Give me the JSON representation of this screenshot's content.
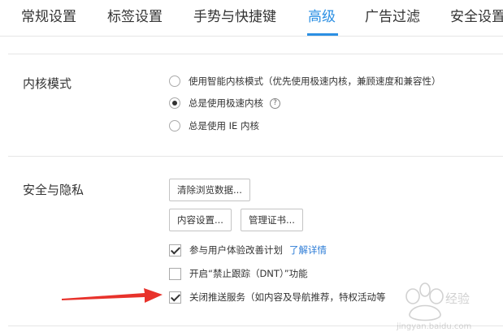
{
  "tabs": [
    {
      "label": "常规设置",
      "active": false
    },
    {
      "label": "标签设置",
      "active": false
    },
    {
      "label": "手势与快捷键",
      "active": false
    },
    {
      "label": "高级",
      "active": true
    },
    {
      "label": "广告过滤",
      "active": false
    },
    {
      "label": "安全设置",
      "active": false
    }
  ],
  "kernel": {
    "title": "内核模式",
    "options": [
      {
        "label": "使用智能内核模式（优先使用极速内核，兼顾速度和兼容性）",
        "checked": false
      },
      {
        "label": "总是使用极速内核",
        "checked": true,
        "help": "?"
      },
      {
        "label": "总是使用 IE 内核",
        "checked": false
      }
    ]
  },
  "privacy": {
    "title": "安全与隐私",
    "buttons": {
      "clear_data": "清除浏览数据...",
      "content_settings": "内容设置...",
      "manage_certs": "管理证书..."
    },
    "checkboxes": [
      {
        "label": "参与用户体验改善计划",
        "checked": true,
        "link": "了解详情"
      },
      {
        "label": "开启“禁止跟踪（DNT）”功能",
        "checked": false
      },
      {
        "label": "关闭推送服务（如内容及导航推荐，特权活动等",
        "checked": true
      }
    ]
  },
  "colors": {
    "accent": "#2b8fe3",
    "link": "#2b7bd6",
    "arrow": "#e8322b"
  },
  "annotation": {
    "arrow_icon": "red-arrow-icon"
  },
  "watermark": {
    "brand": "Baidu经验",
    "url": "jingyan.baidu.com"
  }
}
